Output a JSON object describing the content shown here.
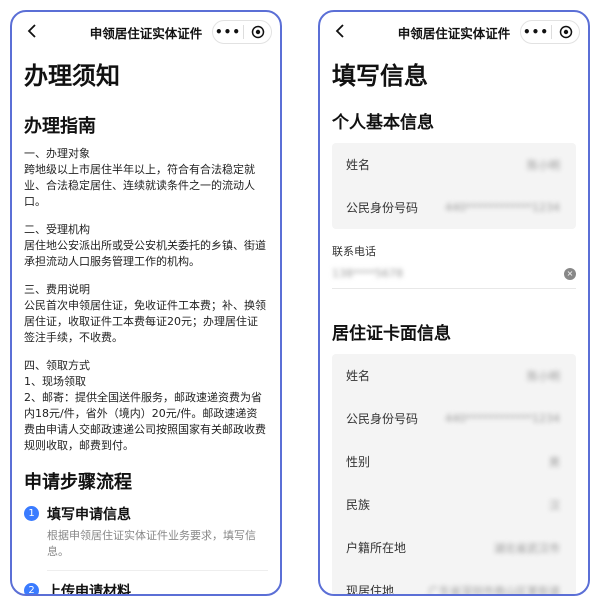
{
  "left": {
    "nav_title": "申领居住证实体证件",
    "page_title": "办理须知",
    "guide_heading": "办理指南",
    "guide": [
      {
        "title": "一、办理对象",
        "body": "跨地级以上市居住半年以上，符合有合法稳定就业、合法稳定居住、连续就读条件之一的流动人口。"
      },
      {
        "title": "二、受理机构",
        "body": "居住地公安派出所或受公安机关委托的乡镇、街道承担流动人口服务管理工作的机构。"
      },
      {
        "title": "三、费用说明",
        "body": "公民首次申领居住证，免收证件工本费；补、换领居住证，收取证件工本费每证20元；办理居住证签注手续，不收费。"
      },
      {
        "title": "四、领取方式",
        "body": "1、现场领取\n2、邮寄：提供全国送件服务，邮政速递资费为省内18元/件，省外（境内）20元/件。邮政速递资费由申请人交邮政速递公司按照国家有关邮政收费规则收取，邮费到付。"
      }
    ],
    "steps_heading": "申请步骤流程",
    "steps": [
      {
        "num": "1",
        "title": "填写申请信息",
        "desc": "根据申领居住证实体证件业务要求，填写信息。"
      },
      {
        "num": "2",
        "title": "上传申请材料"
      }
    ]
  },
  "right": {
    "nav_title": "申领居住证实体证件",
    "page_title": "填写信息",
    "basic_heading": "个人基本信息",
    "basic_rows": [
      {
        "label": "姓名",
        "value": "陈小明"
      },
      {
        "label": "公民身份号码",
        "value": "440************1234"
      }
    ],
    "phone_label": "联系电话",
    "phone_value": "138****5678",
    "card_heading": "居住证卡面信息",
    "card_rows": [
      {
        "label": "姓名",
        "value": "陈小明"
      },
      {
        "label": "公民身份号码",
        "value": "440************1234"
      },
      {
        "label": "性别",
        "value": "男"
      },
      {
        "label": "民族",
        "value": "汉"
      },
      {
        "label": "户籍所在地",
        "value": "湖北省武汉市"
      },
      {
        "label": "现居住地",
        "value": "广东省深圳市南山区某街道"
      }
    ]
  },
  "icons": {
    "back": "chevron-left-icon",
    "more": "more-dots-icon",
    "close": "target-circle-icon",
    "clear": "clear-x-icon"
  },
  "capsule": {
    "more_text": "•••"
  },
  "clear_glyph": "×",
  "colors": {
    "frame": "#5b6fd6",
    "accent": "#3a7bff",
    "card_bg": "#f4f4f4"
  }
}
